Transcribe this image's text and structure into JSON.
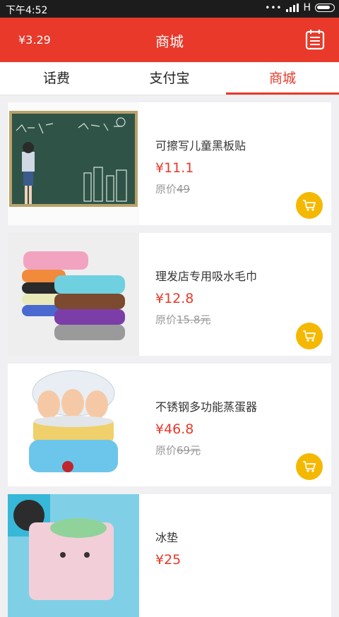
{
  "status_bar": {
    "time": "下午4:52",
    "network": "H"
  },
  "header": {
    "balance": "¥3.29",
    "title": "商城",
    "menu_icon": "calendar-list-icon"
  },
  "tabs": [
    {
      "label": "话费",
      "active": false
    },
    {
      "label": "支付宝",
      "active": false
    },
    {
      "label": "商城",
      "active": true
    }
  ],
  "colors": {
    "brand": "#e8392a",
    "cart": "#f5b800",
    "status": "#1c1c1c"
  },
  "products": [
    {
      "name": "可擦写儿童黑板贴",
      "price": "¥11.1",
      "orig_label": "原价",
      "orig_value": "49",
      "cart_icon": "cart-icon"
    },
    {
      "name": "理发店专用吸水毛巾",
      "price": "¥12.8",
      "orig_label": "原价",
      "orig_value": "15.8元",
      "cart_icon": "cart-icon"
    },
    {
      "name": "不锈钢多功能蒸蛋器",
      "price": "¥46.8",
      "orig_label": "原价",
      "orig_value": "69元",
      "cart_icon": "cart-icon"
    },
    {
      "name": "冰垫",
      "price": "¥25",
      "orig_label": "",
      "orig_value": "",
      "cart_icon": "cart-icon"
    }
  ]
}
